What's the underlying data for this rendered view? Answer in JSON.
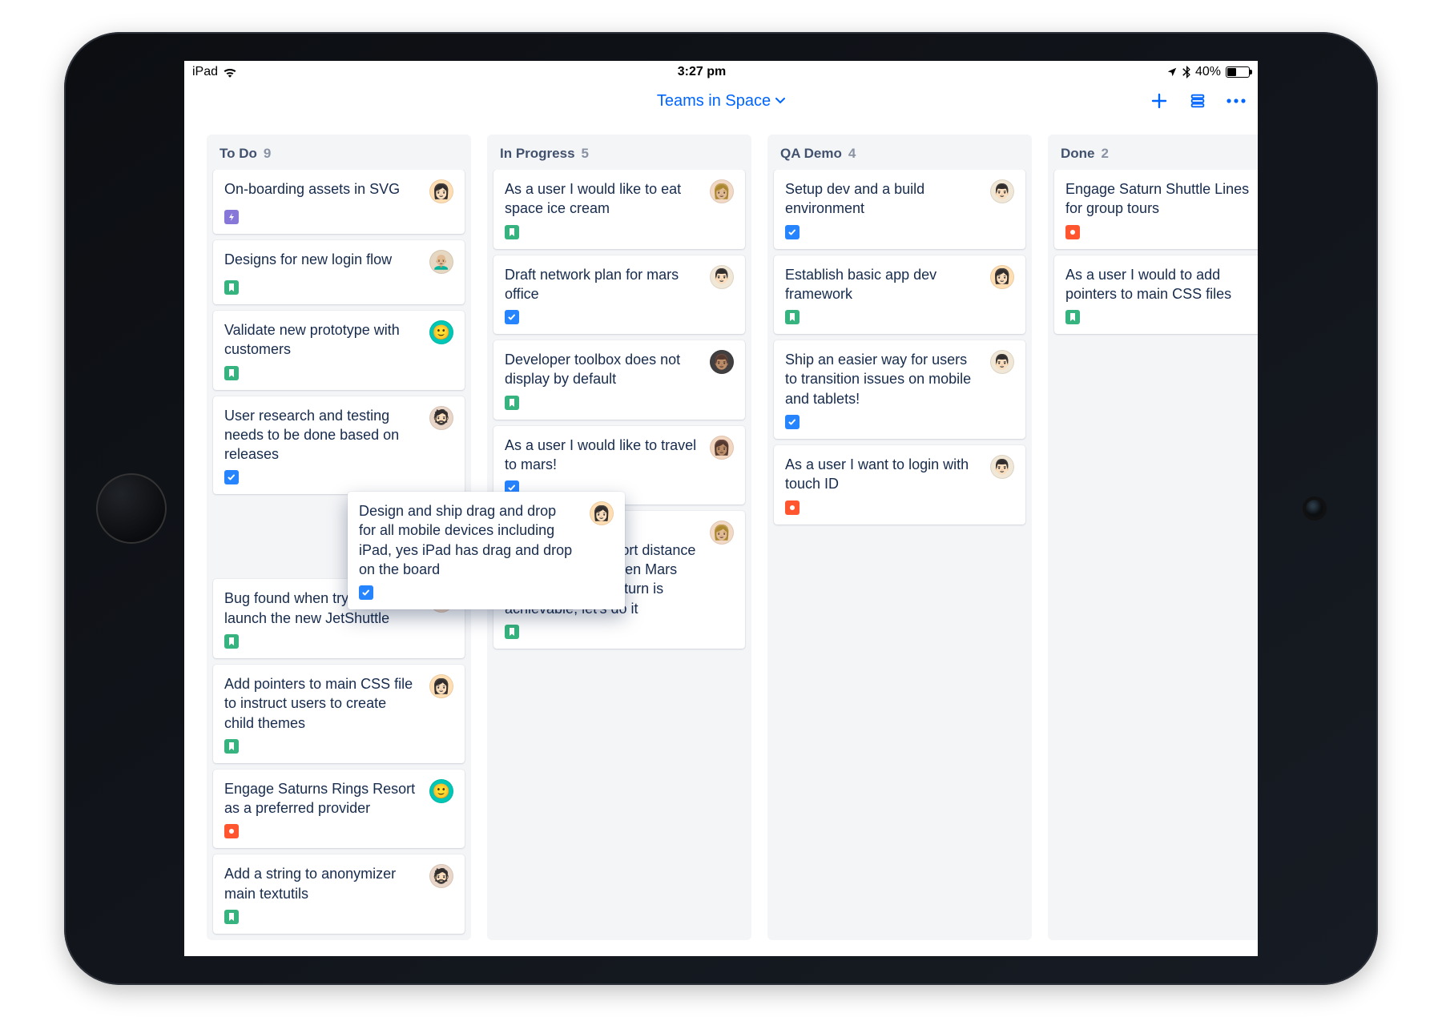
{
  "statusbar": {
    "device": "iPad",
    "time": "3:27 pm",
    "battery_pct": "40%"
  },
  "header": {
    "board_title": "Teams in Space",
    "actions": {
      "add": "＋",
      "filter": "☰",
      "more": "•••"
    }
  },
  "avatars": {
    "a1": {
      "bg": "#FFDEB3",
      "emoji": "👩🏻"
    },
    "a2": {
      "bg": "#E6D7C2",
      "emoji": "👨🏼‍🦲"
    },
    "a3": {
      "bg": "#00C7B6",
      "emoji": "🙂"
    },
    "a4": {
      "bg": "#E9D6C8",
      "emoji": "🧔🏻"
    },
    "a5": {
      "bg": "#F3D6C0",
      "emoji": "👩🏽"
    },
    "a6": {
      "bg": "#413F3F",
      "emoji": "👨🏽"
    },
    "a7": {
      "bg": "#F0E7D7",
      "emoji": "👨🏻"
    },
    "a8": {
      "bg": "#F2D9C5",
      "emoji": "👩🏼"
    }
  },
  "columns": [
    {
      "id": "todo",
      "title": "To Do",
      "count": "9",
      "cards": [
        {
          "text": "On-boarding assets in SVG",
          "tag": "epic",
          "avatar": "a1"
        },
        {
          "text": "Designs for new login flow",
          "tag": "story",
          "avatar": "a2"
        },
        {
          "text": "Validate new prototype with customers",
          "tag": "story",
          "avatar": "a3"
        },
        {
          "text": "User research and testing needs to be done based on releases",
          "tag": "task",
          "avatar": "a4"
        },
        {
          "text": "",
          "tag": "",
          "avatar": ""
        },
        {
          "text": "Bug found when trying to launch the new  JetShuttle",
          "tag": "story",
          "avatar": "a5"
        },
        {
          "text": "Add pointers to main CSS file to instruct users to create child themes",
          "tag": "story",
          "avatar": "a1"
        },
        {
          "text": "Engage Saturns Rings Resort as a preferred provider",
          "tag": "bug",
          "avatar": "a3"
        },
        {
          "text": "Add a string to anonymizer main textutils",
          "tag": "story",
          "avatar": "a4"
        }
      ]
    },
    {
      "id": "inprogress",
      "title": "In Progress",
      "count": "5",
      "cards": [
        {
          "text": "As a user I would like to eat space ice cream",
          "tag": "story",
          "avatar": "a8"
        },
        {
          "text": "Draft network plan for mars office",
          "tag": "task",
          "avatar": "a7"
        },
        {
          "text": "Developer toolbox does not display by default",
          "tag": "story",
          "avatar": "a6"
        },
        {
          "text": "As a user I would like to travel to mars!",
          "tag": "task",
          "avatar": "a5"
        },
        {
          "text": "Engage JetShuttle SpaceWays for short distance space travel between Mars and Earth but if Saturn is achievable, let's do it",
          "tag": "story",
          "avatar": "a8"
        }
      ]
    },
    {
      "id": "qademo",
      "title": "QA Demo",
      "count": "4",
      "cards": [
        {
          "text": "Setup dev and a build environment",
          "tag": "task",
          "avatar": "a7"
        },
        {
          "text": "Establish basic app dev framework",
          "tag": "story",
          "avatar": "a1"
        },
        {
          "text": "Ship an easier way for users to transition issues on mobile and tablets!",
          "tag": "task",
          "avatar": "a7"
        },
        {
          "text": "As a user I want to login with touch ID",
          "tag": "bug",
          "avatar": "a7"
        }
      ]
    },
    {
      "id": "done",
      "title": "Done",
      "count": "2",
      "cards": [
        {
          "text": "Engage Saturn Shuttle Lines for group tours",
          "tag": "bug",
          "avatar": "a5"
        },
        {
          "text": "As a user I would to add pointers to main CSS files",
          "tag": "story",
          "avatar": "a1"
        }
      ]
    }
  ],
  "floating_card": {
    "text": "Design and ship drag and drop for all mobile devices including iPad, yes iPad has drag and drop on the board",
    "tag": "task",
    "avatar": "a1"
  }
}
